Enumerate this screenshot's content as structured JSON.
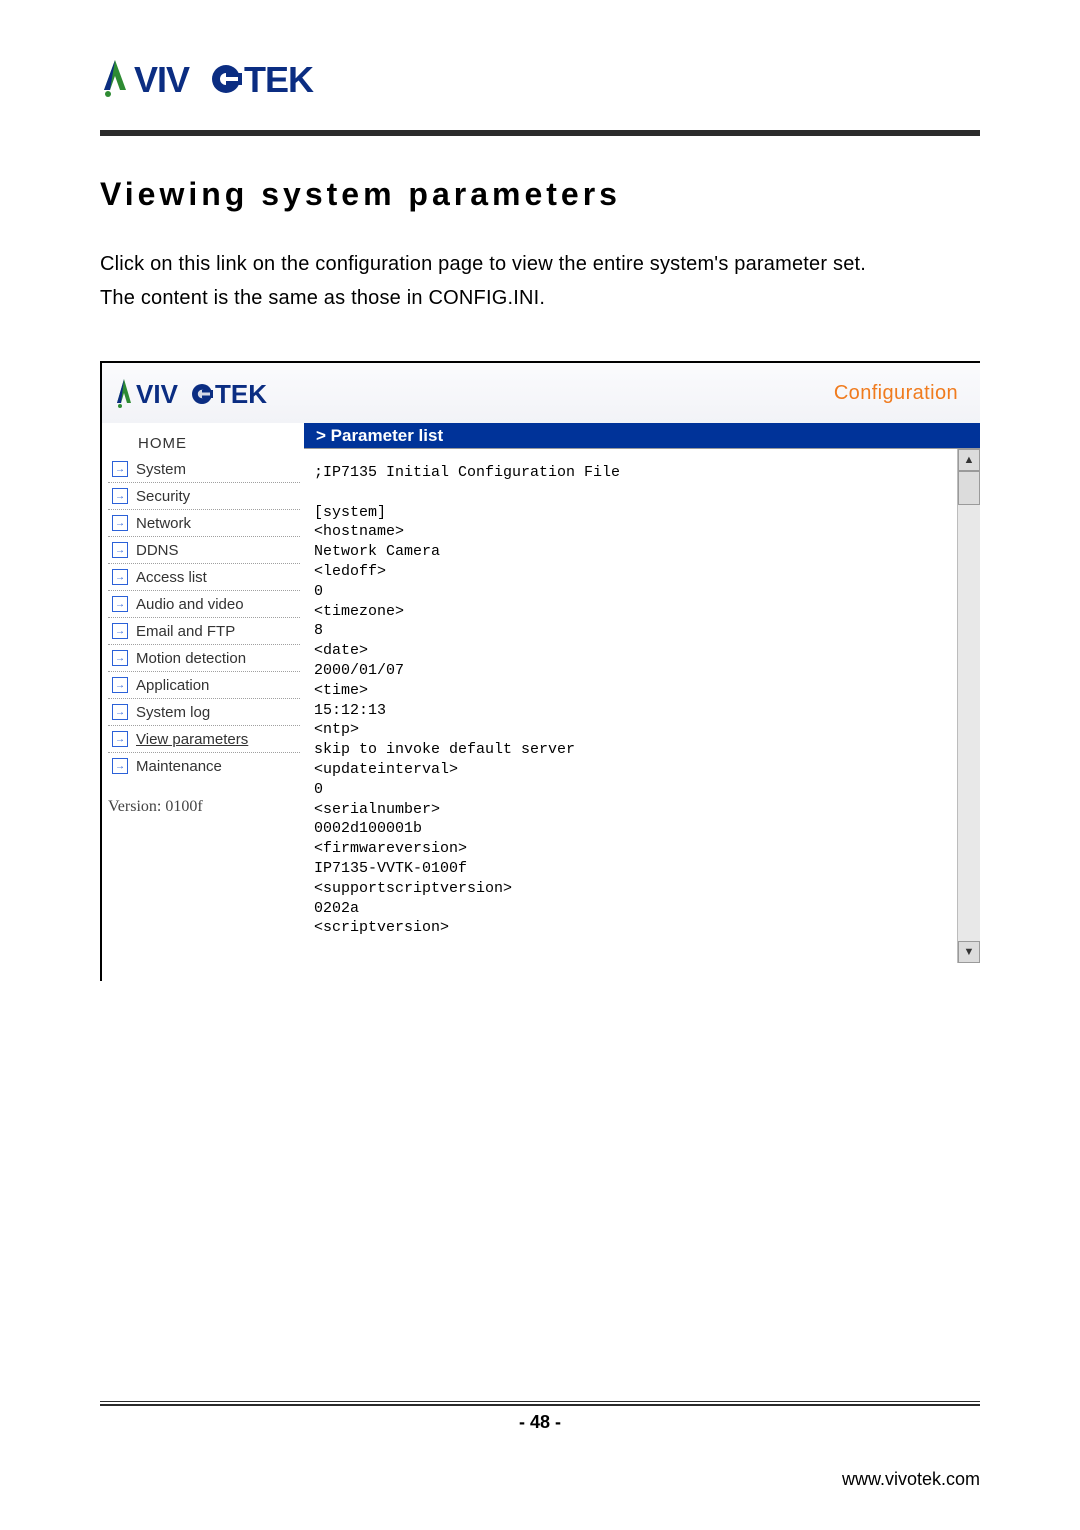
{
  "doc": {
    "section_title": "Viewing system parameters",
    "desc_line1": "Click on this link on the configuration page to view the entire system's parameter set.",
    "desc_line2": "The content is the same as those in CONFIG.INI."
  },
  "screenshot": {
    "config_link": "Configuration",
    "panel_title": "> Parameter list",
    "sidebar": {
      "home": "HOME",
      "items": [
        {
          "label": "System"
        },
        {
          "label": "Security"
        },
        {
          "label": "Network"
        },
        {
          "label": "DDNS"
        },
        {
          "label": "Access list"
        },
        {
          "label": "Audio and video"
        },
        {
          "label": "Email and FTP"
        },
        {
          "label": "Motion detection"
        },
        {
          "label": "Application"
        },
        {
          "label": "System log"
        },
        {
          "label": "View parameters"
        },
        {
          "label": "Maintenance"
        }
      ],
      "version": "Version: 0100f"
    },
    "param_text": ";IP7135 Initial Configuration File\n\n[system]\n<hostname>\nNetwork Camera\n<ledoff>\n0\n<timezone>\n8\n<date>\n2000/01/07\n<time>\n15:12:13\n<ntp>\nskip to invoke default server\n<updateinterval>\n0\n<serialnumber>\n0002d100001b\n<firmwareversion>\nIP7135-VVTK-0100f\n<supportscriptversion>\n0202a\n<scriptversion>"
  },
  "footer": {
    "page_number": "- 48 -",
    "url": "www.vivotek.com"
  },
  "brand": {
    "name": "VIVOTEK",
    "colors": {
      "navy": "#0b2d82",
      "green": "#2e8b33",
      "orange": "#f07b1e",
      "panel_blue": "#003399"
    }
  }
}
